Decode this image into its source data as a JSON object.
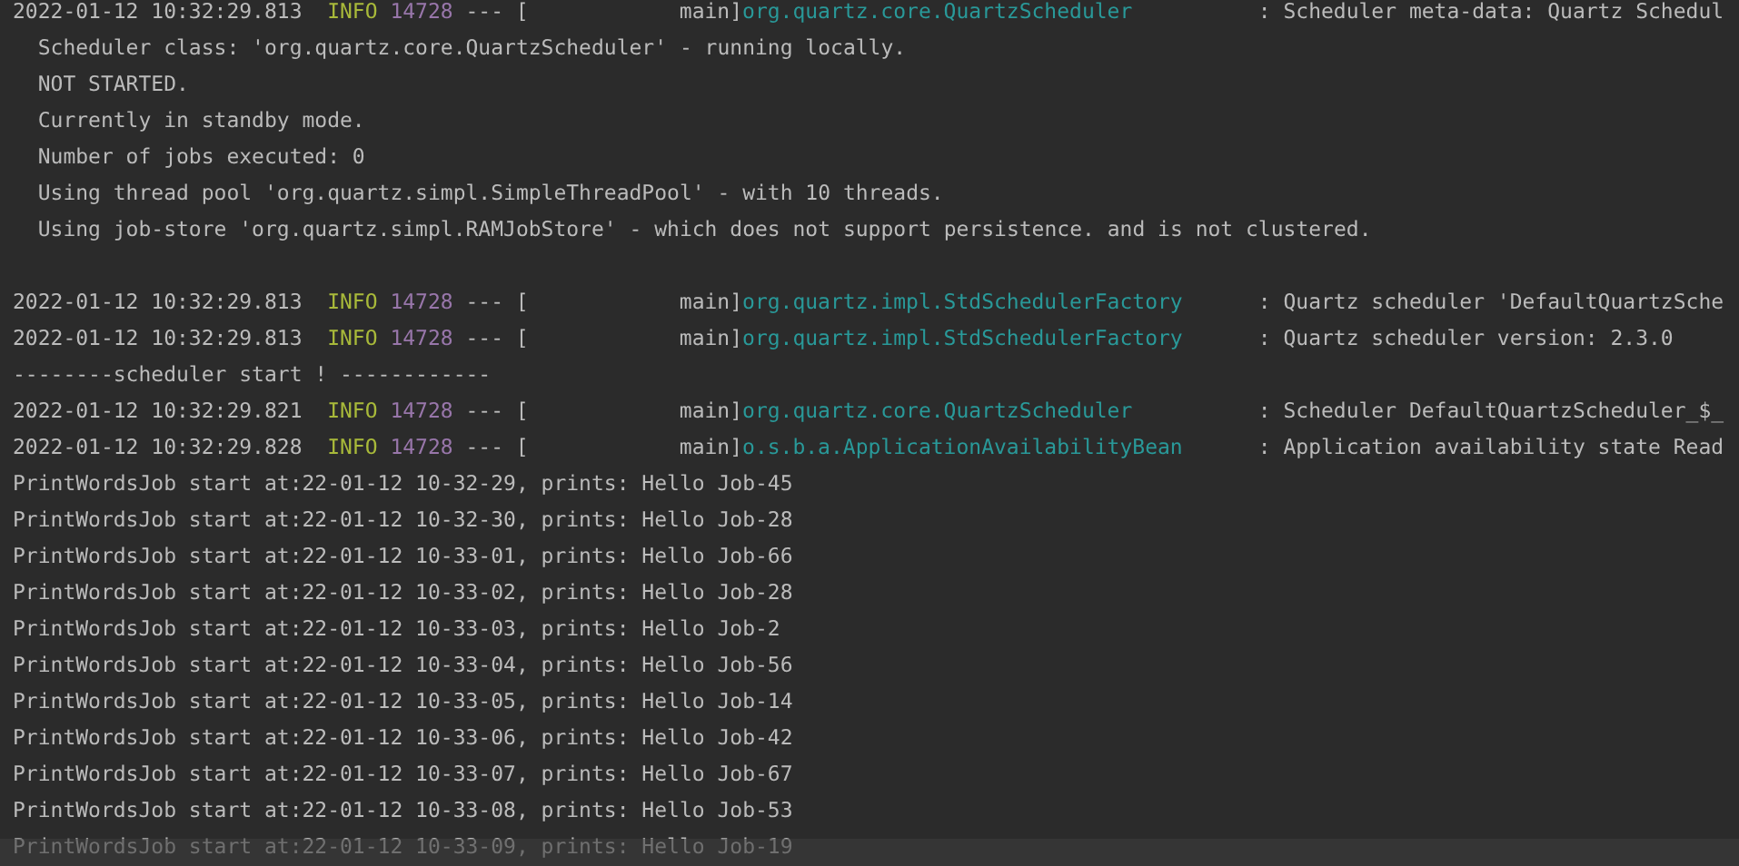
{
  "console": {
    "lines": [
      {
        "kind": "log",
        "timestamp": "2022-01-12 10:32:29.813",
        "level": "INFO",
        "pid": "14728",
        "separator": "---",
        "bracket": "[",
        "thread": "main]",
        "logger": "org.quartz.core.QuartzScheduler",
        "colon": ":",
        "message": "Scheduler meta-data: Quartz Schedul",
        "children": [
          {
            "text": "Scheduler class: 'org.quartz.core.QuartzScheduler' - running locally."
          },
          {
            "text": "NOT STARTED."
          },
          {
            "text": "Currently in standby mode."
          },
          {
            "text": "Number of jobs executed: 0"
          },
          {
            "text": "Using thread pool 'org.quartz.simpl.SimpleThreadPool' - with 10 threads."
          },
          {
            "text": "Using job-store 'org.quartz.simpl.RAMJobStore' - which does not support persistence. and is not clustered."
          }
        ]
      },
      {
        "kind": "blank"
      },
      {
        "kind": "log",
        "timestamp": "2022-01-12 10:32:29.813",
        "level": "INFO",
        "pid": "14728",
        "separator": "---",
        "bracket": "[",
        "thread": "main]",
        "logger": "org.quartz.impl.StdSchedulerFactory",
        "colon": ":",
        "message": "Quartz scheduler 'DefaultQuartzSche"
      },
      {
        "kind": "log",
        "timestamp": "2022-01-12 10:32:29.813",
        "level": "INFO",
        "pid": "14728",
        "separator": "---",
        "bracket": "[",
        "thread": "main]",
        "logger": "org.quartz.impl.StdSchedulerFactory",
        "colon": ":",
        "message": "Quartz scheduler version: 2.3.0"
      },
      {
        "kind": "text",
        "text": "--------scheduler start ! ------------"
      },
      {
        "kind": "log",
        "timestamp": "2022-01-12 10:32:29.821",
        "level": "INFO",
        "pid": "14728",
        "separator": "---",
        "bracket": "[",
        "thread": "main]",
        "logger": "org.quartz.core.QuartzScheduler",
        "colon": ":",
        "message": "Scheduler DefaultQuartzScheduler_$_"
      },
      {
        "kind": "log",
        "timestamp": "2022-01-12 10:32:29.828",
        "level": "INFO",
        "pid": "14728",
        "separator": "---",
        "bracket": "[",
        "thread": "main]",
        "logger": "o.s.b.a.ApplicationAvailabilityBean",
        "colon": ":",
        "message": "Application availability state Read"
      },
      {
        "kind": "text",
        "text": "PrintWordsJob start at:22-01-12 10-32-29, prints: Hello Job-45"
      },
      {
        "kind": "text",
        "text": "PrintWordsJob start at:22-01-12 10-32-30, prints: Hello Job-28"
      },
      {
        "kind": "text",
        "text": "PrintWordsJob start at:22-01-12 10-33-01, prints: Hello Job-66"
      },
      {
        "kind": "text",
        "text": "PrintWordsJob start at:22-01-12 10-33-02, prints: Hello Job-28"
      },
      {
        "kind": "text",
        "text": "PrintWordsJob start at:22-01-12 10-33-03, prints: Hello Job-2"
      },
      {
        "kind": "text",
        "text": "PrintWordsJob start at:22-01-12 10-33-04, prints: Hello Job-56"
      },
      {
        "kind": "text",
        "text": "PrintWordsJob start at:22-01-12 10-33-05, prints: Hello Job-14"
      },
      {
        "kind": "text",
        "text": "PrintWordsJob start at:22-01-12 10-33-06, prints: Hello Job-42"
      },
      {
        "kind": "text",
        "text": "PrintWordsJob start at:22-01-12 10-33-07, prints: Hello Job-67"
      },
      {
        "kind": "text",
        "text": "PrintWordsJob start at:22-01-12 10-33-08, prints: Hello Job-53"
      },
      {
        "kind": "text",
        "text": "PrintWordsJob start at:22-01-12 10-33-09, prints: Hello Job-19"
      }
    ]
  }
}
